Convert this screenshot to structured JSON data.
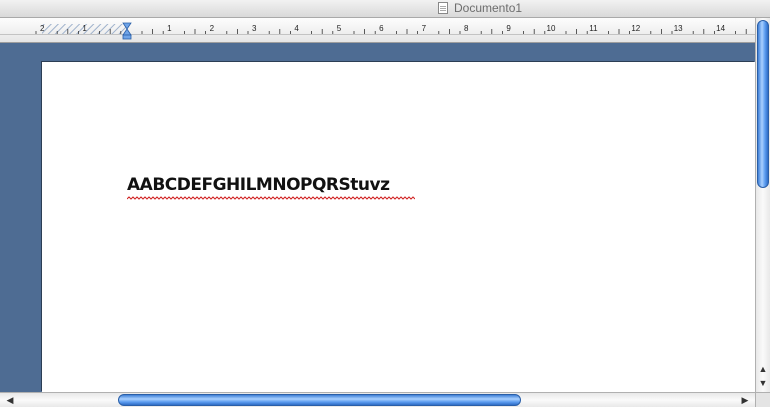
{
  "window": {
    "title": "Documento1",
    "icon": "document-icon"
  },
  "ruler": {
    "labels": [
      "2",
      "1",
      "1",
      "2",
      "3",
      "4",
      "5",
      "6",
      "7",
      "8",
      "9",
      "10",
      "11",
      "12",
      "13",
      "14"
    ]
  },
  "document": {
    "text": "AABCDEFGHILMNOPQRStuvz"
  },
  "scroll": {
    "up_arrow": "▲",
    "down_arrow": "▼",
    "left_arrow": "◀",
    "right_arrow": "▶"
  },
  "colors": {
    "desk": "#4e6c93",
    "scroll_thumb": "#5b9cf0",
    "spell_squiggle": "#d02020"
  }
}
